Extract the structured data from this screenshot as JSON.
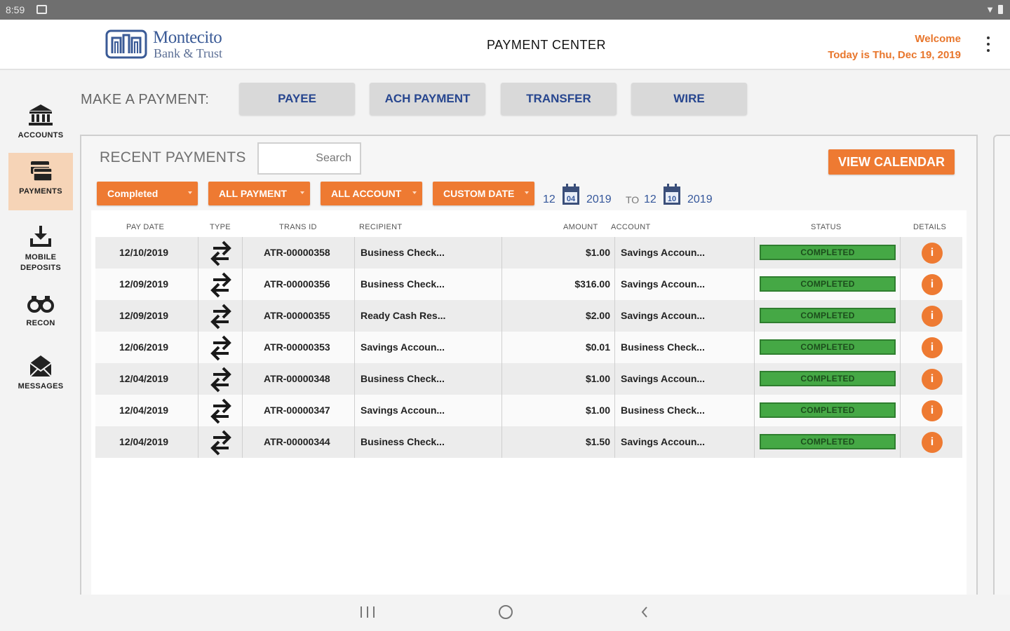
{
  "status_bar": {
    "time": "8:59"
  },
  "header": {
    "logo": {
      "line1": "Montecito",
      "line2": "Bank & Trust"
    },
    "title": "PAYMENT CENTER",
    "welcome": "Welcome",
    "today": "Today is Thu, Dec 19, 2019"
  },
  "sidebar": {
    "items": [
      {
        "label": "ACCOUNTS",
        "icon": "bank-icon"
      },
      {
        "label": "PAYMENTS",
        "icon": "payments-icon",
        "active": true
      },
      {
        "label_line1": "MOBILE",
        "label_line2": "DEPOSITS",
        "icon": "deposit-icon"
      },
      {
        "label": "RECON",
        "icon": "binoculars-icon"
      },
      {
        "label": "MESSAGES",
        "icon": "envelope-icon"
      }
    ]
  },
  "make_payment": {
    "label": "MAKE A PAYMENT:",
    "buttons": [
      "PAYEE",
      "ACH PAYMENT",
      "TRANSFER",
      "WIRE"
    ]
  },
  "recent": {
    "title": "RECENT PAYMENTS",
    "search_placeholder": "Search",
    "view_calendar": "VIEW CALENDAR",
    "filters": [
      "Completed",
      "ALL PAYMENT",
      "ALL ACCOUNT",
      "CUSTOM DATE"
    ],
    "date_from": {
      "month": "12",
      "day": "04",
      "year": "2019"
    },
    "to_label": "TO",
    "date_to": {
      "month": "12",
      "day": "10",
      "year": "2019"
    }
  },
  "table": {
    "headers": [
      "PAY DATE",
      "TYPE",
      "TRANS ID",
      "RECIPIENT",
      "AMOUNT",
      "ACCOUNT",
      "STATUS",
      "DETAILS"
    ],
    "rows": [
      {
        "pay_date": "12/10/2019",
        "trans_id": "ATR-00000358",
        "recipient": "Business Check...",
        "amount": "$1.00",
        "account": "Savings Accoun...",
        "status": "COMPLETED",
        "details": "i"
      },
      {
        "pay_date": "12/09/2019",
        "trans_id": "ATR-00000356",
        "recipient": "Business Check...",
        "amount": "$316.00",
        "account": "Savings Accoun...",
        "status": "COMPLETED",
        "details": "i"
      },
      {
        "pay_date": "12/09/2019",
        "trans_id": "ATR-00000355",
        "recipient": "Ready Cash Res...",
        "amount": "$2.00",
        "account": "Savings Accoun...",
        "status": "COMPLETED",
        "details": "i"
      },
      {
        "pay_date": "12/06/2019",
        "trans_id": "ATR-00000353",
        "recipient": "Savings Accoun...",
        "amount": "$0.01",
        "account": "Business Check...",
        "status": "COMPLETED",
        "details": "i"
      },
      {
        "pay_date": "12/04/2019",
        "trans_id": "ATR-00000348",
        "recipient": "Business Check...",
        "amount": "$1.00",
        "account": "Savings Accoun...",
        "status": "COMPLETED",
        "details": "i"
      },
      {
        "pay_date": "12/04/2019",
        "trans_id": "ATR-00000347",
        "recipient": "Savings Accoun...",
        "amount": "$1.00",
        "account": "Business Check...",
        "status": "COMPLETED",
        "details": "i"
      },
      {
        "pay_date": "12/04/2019",
        "trans_id": "ATR-00000344",
        "recipient": "Business Check...",
        "amount": "$1.50",
        "account": "Savings Accoun...",
        "status": "COMPLETED",
        "details": "i"
      }
    ]
  },
  "colors": {
    "accent": "#ee7a32",
    "brand": "#27468f",
    "status_ok": "#45a845"
  }
}
